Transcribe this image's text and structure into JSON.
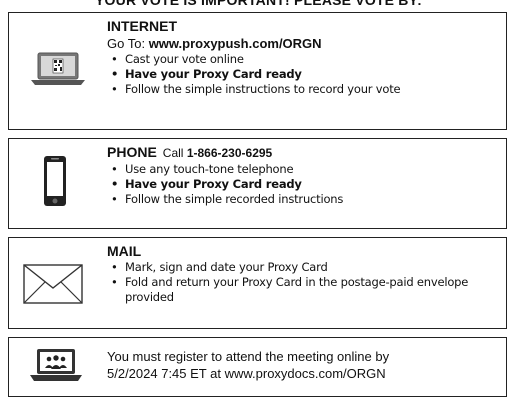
{
  "header": "YOUR VOTE IS IMPORTANT! PLEASE VOTE BY:",
  "internet": {
    "title": "INTERNET",
    "goto_prefix": "Go To: ",
    "url": "www.proxypush.com/ORGN",
    "bullets": [
      "Cast your vote online",
      "Have your Proxy Card ready",
      "Follow the simple instructions to record your vote"
    ]
  },
  "phone": {
    "title": "PHONE",
    "call_prefix": "Call ",
    "number": "1-866-230-6295",
    "bullets": [
      "Use any touch-tone telephone",
      "Have your Proxy Card ready",
      "Follow the simple recorded instructions"
    ]
  },
  "mail": {
    "title": "MAIL",
    "bullets": [
      "Mark, sign and date your Proxy Card",
      "Fold and return your Proxy Card in the postage-paid envelope provided"
    ]
  },
  "register": {
    "line1": "You must register to attend the meeting online by",
    "line2": "5/2/2024 7:45 ET at www.proxydocs.com/ORGN"
  },
  "icons": {
    "internet": "laptop-qr-icon",
    "phone": "mobile-phone-icon",
    "mail": "envelope-icon",
    "register": "laptop-people-icon"
  }
}
